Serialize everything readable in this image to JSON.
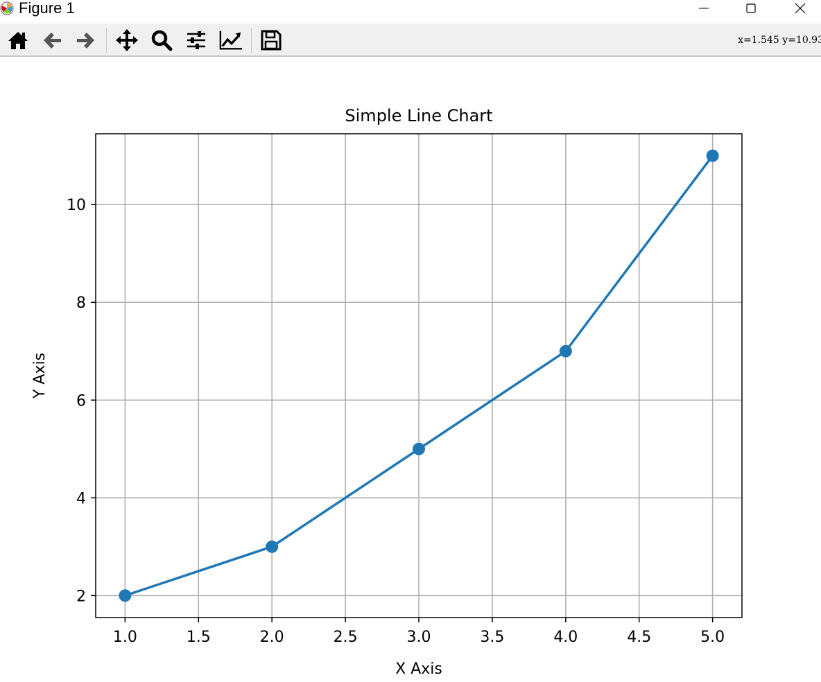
{
  "window": {
    "title": "Figure 1",
    "controls": {
      "minimize": "minimize",
      "maximize": "maximize",
      "close": "close"
    }
  },
  "toolbar": {
    "tools": [
      {
        "name": "home-icon"
      },
      {
        "name": "back-icon"
      },
      {
        "name": "forward-icon"
      },
      {
        "name": "pan-icon"
      },
      {
        "name": "zoom-icon"
      },
      {
        "name": "subplots-icon"
      },
      {
        "name": "customize-icon"
      },
      {
        "name": "save-icon"
      }
    ],
    "coords": "x=1.545 y=10.93"
  },
  "colors": {
    "series": "#1f77b4",
    "grid": "#b0b0b0",
    "toolbar_bg": "#f0f0f0"
  },
  "chart_data": {
    "type": "line",
    "title": "Simple Line Chart",
    "xlabel": "X Axis",
    "ylabel": "Y Axis",
    "x": [
      1,
      2,
      3,
      4,
      5
    ],
    "series": [
      {
        "values": [
          2,
          3,
          5,
          7,
          11
        ],
        "marker": "circle"
      }
    ],
    "xlim": [
      0.8,
      5.2
    ],
    "ylim": [
      1.55,
      11.45
    ],
    "xticks": [
      "1.0",
      "1.5",
      "2.0",
      "2.5",
      "3.0",
      "3.5",
      "4.0",
      "4.5",
      "5.0"
    ],
    "yticks": [
      "2",
      "4",
      "6",
      "8",
      "10"
    ],
    "grid": true
  }
}
